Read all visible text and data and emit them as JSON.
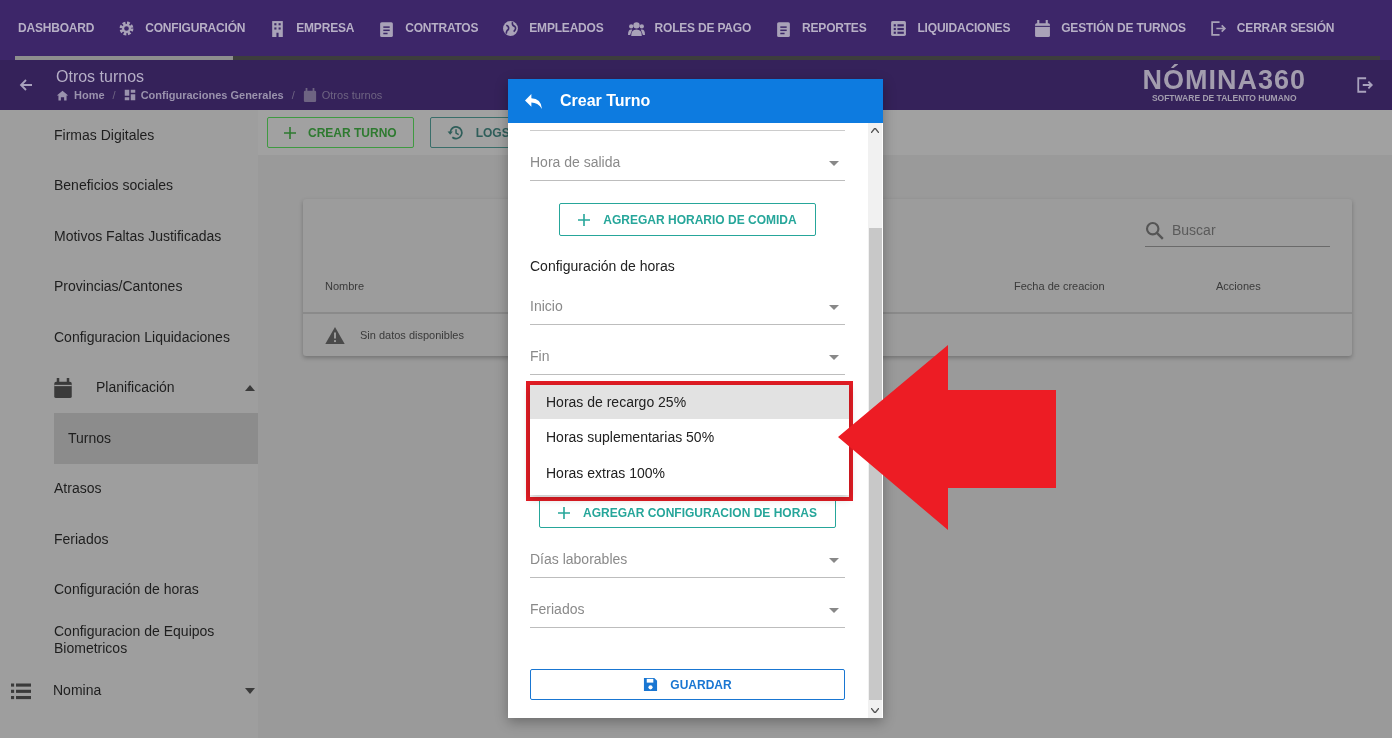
{
  "nav": {
    "items": [
      {
        "label": "DASHBOARD"
      },
      {
        "label": "CONFIGURACIÓN"
      },
      {
        "label": "EMPRESA"
      },
      {
        "label": "CONTRATOS"
      },
      {
        "label": "EMPLEADOS"
      },
      {
        "label": "ROLES DE PAGO"
      },
      {
        "label": "REPORTES"
      },
      {
        "label": "LIQUIDACIONES"
      },
      {
        "label": "GESTIÓN DE TURNOS"
      },
      {
        "label": "CERRAR SESIÓN"
      }
    ],
    "progress": {
      "level": 0.16
    }
  },
  "header": {
    "title": "Otros turnos",
    "breadcrumb": [
      "Home",
      "Configuraciones Generales",
      "Otros turnos"
    ],
    "breadcrumb_separators": [
      "/",
      "/"
    ],
    "logo": "NÓMINA360",
    "tagline": "SOFTWARE DE TALENTO HUMANO"
  },
  "sidebar": {
    "items": [
      {
        "kind": "link",
        "label": "Firmas Digitales",
        "selected": false
      },
      {
        "kind": "link",
        "label": "Beneficios sociales",
        "selected": false
      },
      {
        "kind": "link",
        "label": "Motivos Faltas Justificadas",
        "selected": false
      },
      {
        "kind": "link",
        "label": "Provincias/Cantones",
        "selected": false
      },
      {
        "kind": "link",
        "label": "Configuracion Liquidaciones",
        "selected": false
      },
      {
        "kind": "group",
        "label": "Planificación",
        "selected": false,
        "expanded": true,
        "children": [
          {
            "label": "Turnos",
            "selected": true
          }
        ]
      },
      {
        "kind": "link",
        "label": "Atrasos",
        "selected": false
      },
      {
        "kind": "link",
        "label": "Feriados",
        "selected": false
      },
      {
        "kind": "link",
        "label": "Configuración de horas",
        "selected": false
      },
      {
        "kind": "link",
        "label": "Configuracion de Equipos Biometricos",
        "selected": false
      },
      {
        "kind": "group",
        "label": "Nomina",
        "selected": false,
        "expanded": false
      }
    ]
  },
  "toolbar": {
    "buttons": [
      "CREAR TURNO",
      "LOGS"
    ]
  },
  "table": {
    "search": {
      "placeholder": "Buscar"
    },
    "columns": [
      "Nombre",
      "Fecha de creacion",
      "Acciones"
    ],
    "empty": "Sin datos disponibles"
  },
  "dialog": {
    "title": "Crear Turno",
    "fields": [
      {
        "kind": "select",
        "label": "Hora de salida"
      },
      {
        "kind": "button",
        "label": "AGREGAR HORARIO DE COMIDA"
      },
      {
        "kind": "heading",
        "label": "Configuración de horas"
      },
      {
        "kind": "select",
        "label": "Inicio"
      },
      {
        "kind": "select",
        "label": "Fin"
      },
      {
        "kind": "button",
        "label": "AGREGAR CONFIGURACION DE HORAS"
      },
      {
        "kind": "select",
        "label": "Días laborables"
      },
      {
        "kind": "select",
        "label": "Feriados"
      }
    ],
    "save": "GUARDAR",
    "menu": [
      {
        "label": "Horas de recargo 25%",
        "selected": true
      },
      {
        "label": "Horas suplementarias 50%",
        "selected": false
      },
      {
        "label": "Horas extras 100%",
        "selected": false
      }
    ]
  }
}
